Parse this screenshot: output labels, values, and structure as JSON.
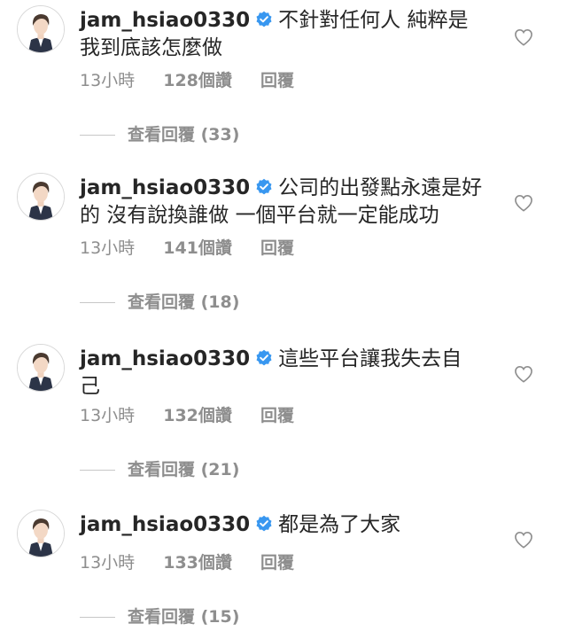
{
  "comments": [
    {
      "username": "jam_hsiao0330",
      "text": "不針對任何人 純粹是我到底該怎麼做",
      "time": "13小時",
      "likes": "128個讚",
      "reply_label": "回覆",
      "view_replies": "查看回覆 (33)"
    },
    {
      "username": "jam_hsiao0330",
      "text": "公司的出發點永遠是好的 沒有說換誰做 一個平台就一定能成功",
      "time": "13小時",
      "likes": "141個讚",
      "reply_label": "回覆",
      "view_replies": "查看回覆 (18)"
    },
    {
      "username": "jam_hsiao0330",
      "text": "這些平台讓我失去自己",
      "time": "13小時",
      "likes": "132個讚",
      "reply_label": "回覆",
      "view_replies": "查看回覆 (21)"
    },
    {
      "username": "jam_hsiao0330",
      "text": "都是為了大家",
      "time": "13小時",
      "likes": "133個讚",
      "reply_label": "回覆",
      "view_replies": "查看回覆 (15)"
    }
  ],
  "colors": {
    "text": "#262626",
    "meta": "#8e8e8e",
    "verified": "#3897f0"
  },
  "icons": {
    "verified": "verified-badge-icon",
    "like": "heart-outline-icon"
  }
}
